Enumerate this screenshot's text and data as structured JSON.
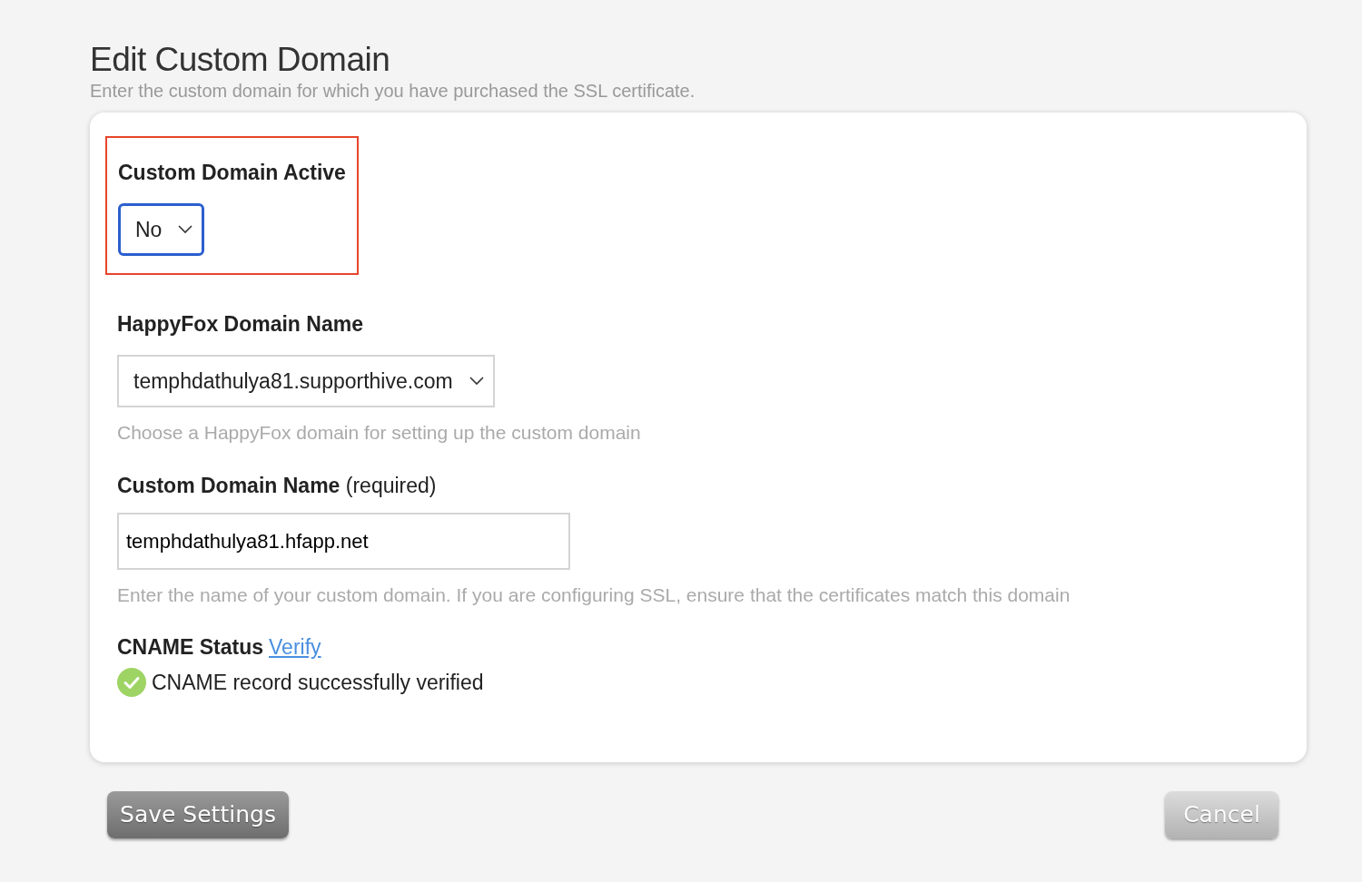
{
  "header": {
    "title": "Edit Custom Domain",
    "subtitle": "Enter the custom domain for which you have purchased the SSL certificate."
  },
  "fields": [
    {
      "kind": "select",
      "label": "Custom Domain Active",
      "value": "No",
      "focused": true,
      "highlighted": true
    },
    {
      "kind": "select",
      "label": "HappyFox Domain Name",
      "value": "temphdathulya81.supporthive.com",
      "focused": false,
      "highlighted": false,
      "help": "Choose a HappyFox domain for setting up the custom domain"
    },
    {
      "kind": "text",
      "label": "Custom Domain Name",
      "label_note": "(required)",
      "value": "temphdathulya81.hfapp.net",
      "focused": false,
      "highlighted": false,
      "help": "Enter the name of your custom domain. If you are configuring SSL, ensure that the certificates match this domain"
    },
    {
      "kind": "status",
      "label": "CNAME Status",
      "link": "Verify",
      "status": "CNAME record successfully verified",
      "verified": true,
      "highlighted": false
    }
  ],
  "buttons": [
    {
      "label": "Save Settings",
      "kind": "primary"
    },
    {
      "label": "Cancel",
      "kind": "secondary"
    }
  ]
}
